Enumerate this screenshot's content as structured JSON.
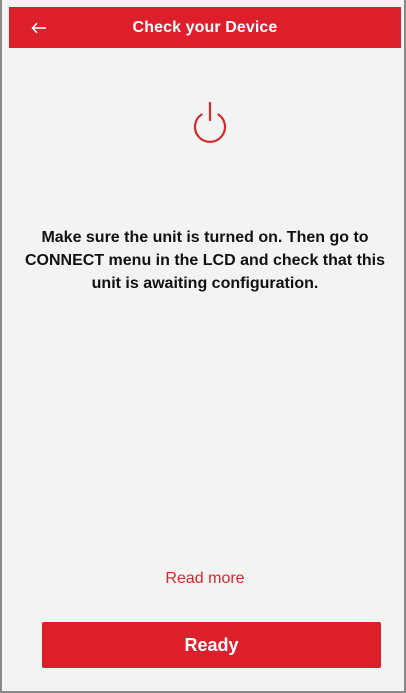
{
  "header": {
    "title": "Check your Device",
    "back_icon": "arrow-left-icon"
  },
  "content": {
    "status_icon": "power-icon",
    "message": "Make sure the unit is turned on. Then go to\nCONNECT menu in the LCD and check that this\nunit is awaiting configuration."
  },
  "footer": {
    "read_more": "Read more",
    "ready_label": "Ready"
  },
  "colors": {
    "accent": "#dc1f2b",
    "link": "#d42a2a",
    "background": "#f3f3f3"
  }
}
